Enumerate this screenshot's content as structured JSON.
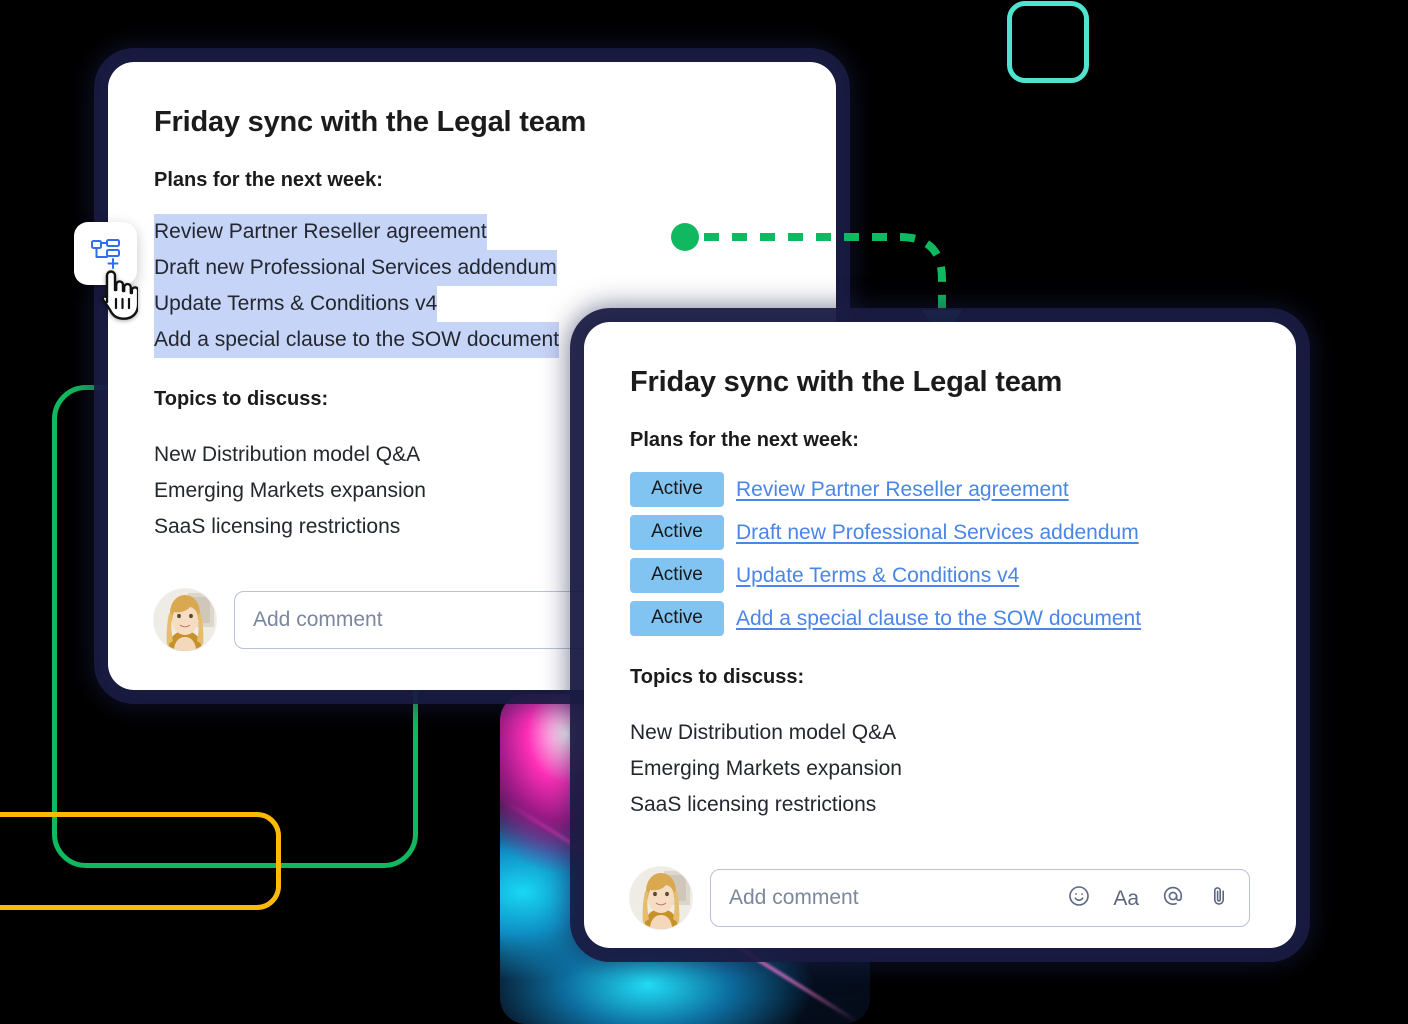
{
  "card1": {
    "title": "Friday sync with the Legal team",
    "plans_label": "Plans for the next week:",
    "plans": [
      "Review Partner Reseller agreement",
      "Draft new Professional Services addendum",
      "Update Terms & Conditions v4",
      "Add a special clause to the SOW document"
    ],
    "topics_label": "Topics to discuss:",
    "topics": [
      "New Distribution model Q&A",
      "Emerging Markets expansion",
      "SaaS licensing restrictions"
    ],
    "comment": {
      "placeholder": "Add comment",
      "avatar_name": "user-avatar"
    }
  },
  "card2": {
    "title": "Friday sync with the Legal team",
    "plans_label": "Plans for the next week:",
    "plans": [
      {
        "status": "Active",
        "label": "Review Partner Reseller agreement"
      },
      {
        "status": "Active",
        "label": "Draft new Professional Services addendum"
      },
      {
        "status": "Active",
        "label": "Update Terms & Conditions v4"
      },
      {
        "status": "Active",
        "label": "Add a special clause to the SOW document"
      }
    ],
    "topics_label": "Topics to discuss:",
    "topics": [
      "New Distribution model Q&A",
      "Emerging Markets expansion",
      "SaaS licensing restrictions"
    ],
    "comment": {
      "placeholder": "Add comment",
      "tools": [
        "emoji-icon",
        "format-text-icon",
        "mention-icon",
        "attachment-icon"
      ],
      "format_label": "Aa",
      "mention_label": "@"
    }
  },
  "overlay": {
    "chip_icon": "create-task-from-text-icon",
    "cursor": "pointing-hand-cursor"
  },
  "decor": {
    "teal_square": "teal-rounded-square-outline",
    "green_rect": "green-rounded-rect-outline",
    "yellow_rect": "yellow-rounded-rect-outline",
    "photo": "abstract-gradient-image",
    "connector": "green-dashed-arrow"
  },
  "colors": {
    "selection_highlight": "#c6d4f7",
    "status_badge": "#81c3f1",
    "link": "#4a86e8",
    "teal": "#4fe3d0",
    "green": "#10b95f",
    "yellow": "#fbba07",
    "chip_icon": "#2f6ef0",
    "card_shadow": "#1a1b42"
  }
}
